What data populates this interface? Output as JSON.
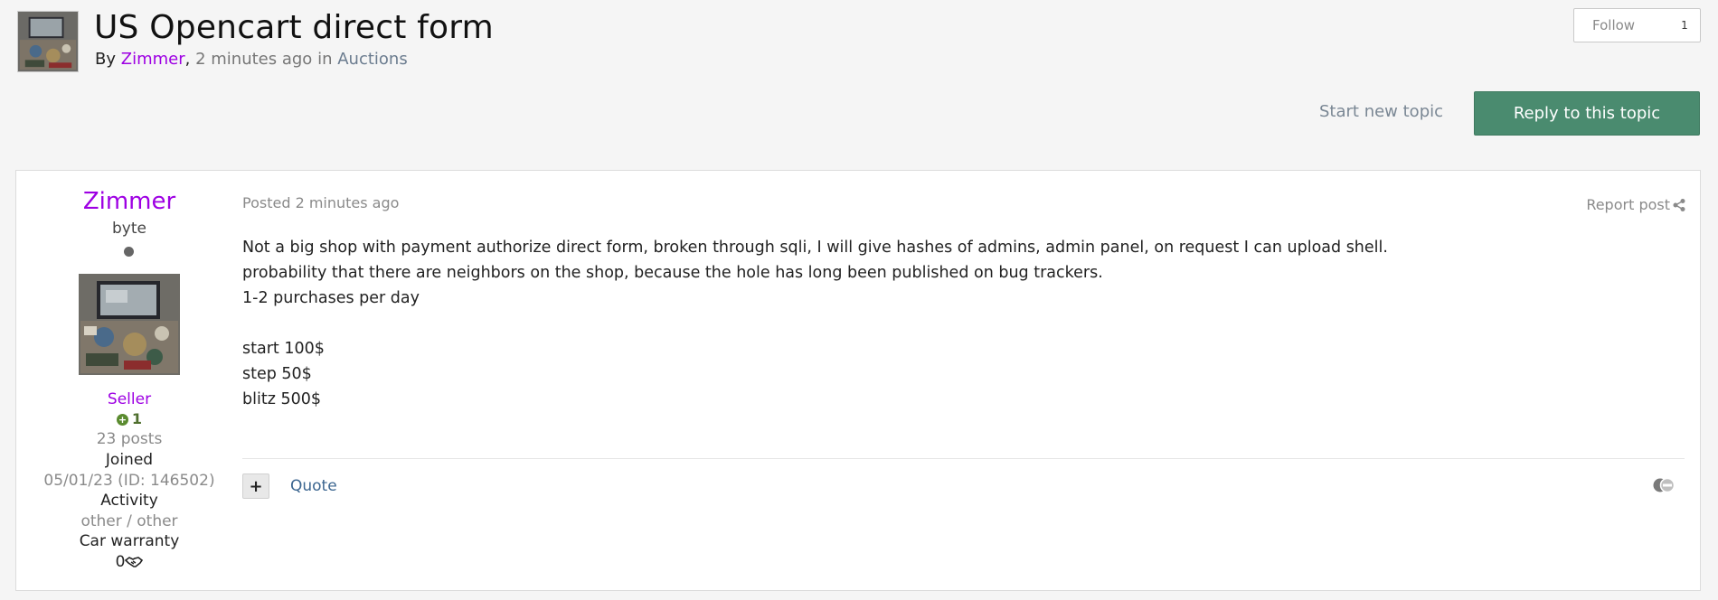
{
  "topic": {
    "title": "US Opencart direct form",
    "by_label": "By",
    "author": "Zimmer",
    "time": "2 minutes ago",
    "in_label": "in",
    "forum": "Auctions"
  },
  "follow": {
    "label": "Follow",
    "count": "1"
  },
  "actions": {
    "start_topic": "Start new topic",
    "reply": "Reply to this topic"
  },
  "author_panel": {
    "name": "Zimmer",
    "rank": "byte",
    "group": "Seller",
    "reputation": "1",
    "posts": "23 posts",
    "joined_label": "Joined",
    "joined_value": "05/01/23 (ID: 146502)",
    "activity_label": "Activity",
    "activity_value": "other / other",
    "warranty_label": "Car warranty",
    "warranty_value": "0"
  },
  "post": {
    "posted": "Posted 2 minutes ago",
    "report": "Report post",
    "lines": [
      "Not a big shop with payment authorize direct form, broken through sqli, I will give hashes of admins, admin panel, on request I can upload shell.",
      "probability that there are neighbors on the shop, because the hole has long been published on bug trackers.",
      "1-2 purchases per day",
      "",
      "start 100$",
      "step 50$",
      "blitz 500$"
    ],
    "quote": "Quote"
  },
  "colors": {
    "author": "#9e00e3",
    "reply_button": "#4a8b6f",
    "link": "#3c6690",
    "reputation": "#5a8b2f"
  },
  "icons": [
    "share-icon",
    "plus-icon",
    "reaction-icon",
    "handshake-icon",
    "status-dot-icon"
  ]
}
